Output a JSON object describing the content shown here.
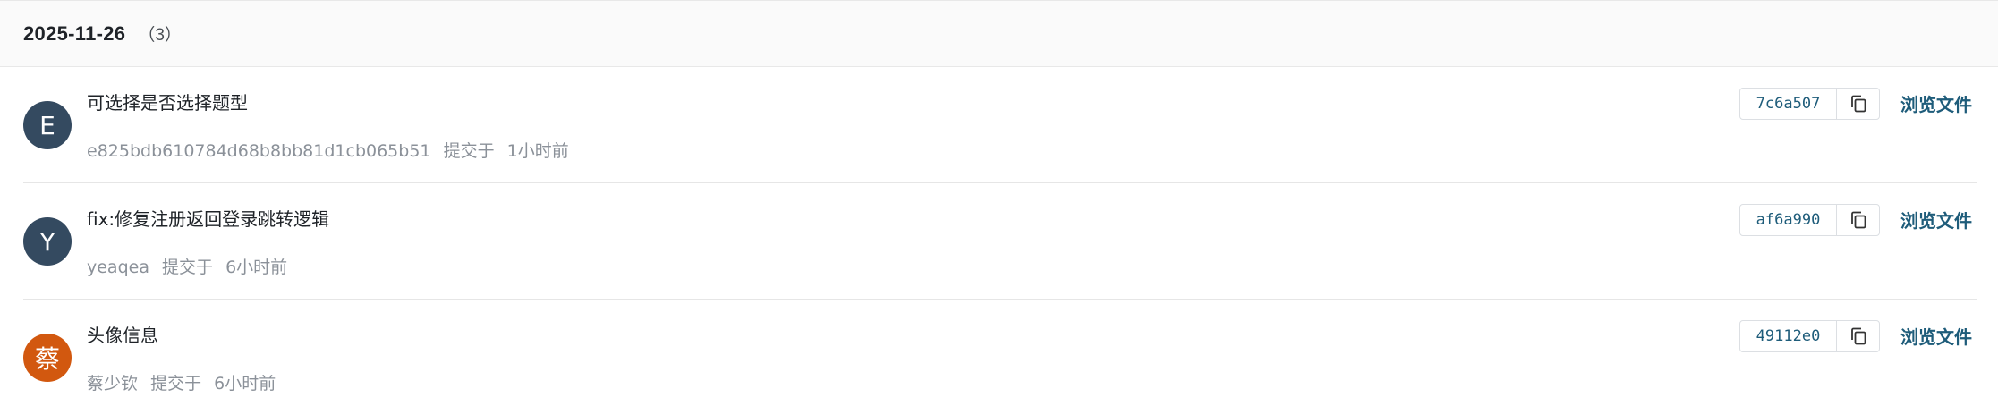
{
  "group": {
    "date": "2025-11-26",
    "count": "（3）"
  },
  "commits": [
    {
      "avatar_letter": "E",
      "avatar_color": "#344a60",
      "message": "可选择是否选择题型",
      "author": "e825bdb610784d68b8bb81d1cb065b51",
      "action": "提交于",
      "time": "1小时前",
      "sha": "7c6a507",
      "copy_icon": "copy-icon",
      "browse_label": "浏览文件"
    },
    {
      "avatar_letter": "Y",
      "avatar_color": "#344a60",
      "message": "fix:修复注册返回登录跳转逻辑",
      "author": "yeaqea",
      "action": "提交于",
      "time": "6小时前",
      "sha": "af6a990",
      "copy_icon": "copy-icon",
      "browse_label": "浏览文件"
    },
    {
      "avatar_letter": "蔡",
      "avatar_color": "#d2580f",
      "message": "头像信息",
      "author": "蔡少钦",
      "action": "提交于",
      "time": "6小时前",
      "sha": "49112e0",
      "copy_icon": "copy-icon",
      "browse_label": "浏览文件"
    }
  ],
  "colors": {
    "link": "#1e5c7a",
    "header_bg": "#fafafa"
  }
}
